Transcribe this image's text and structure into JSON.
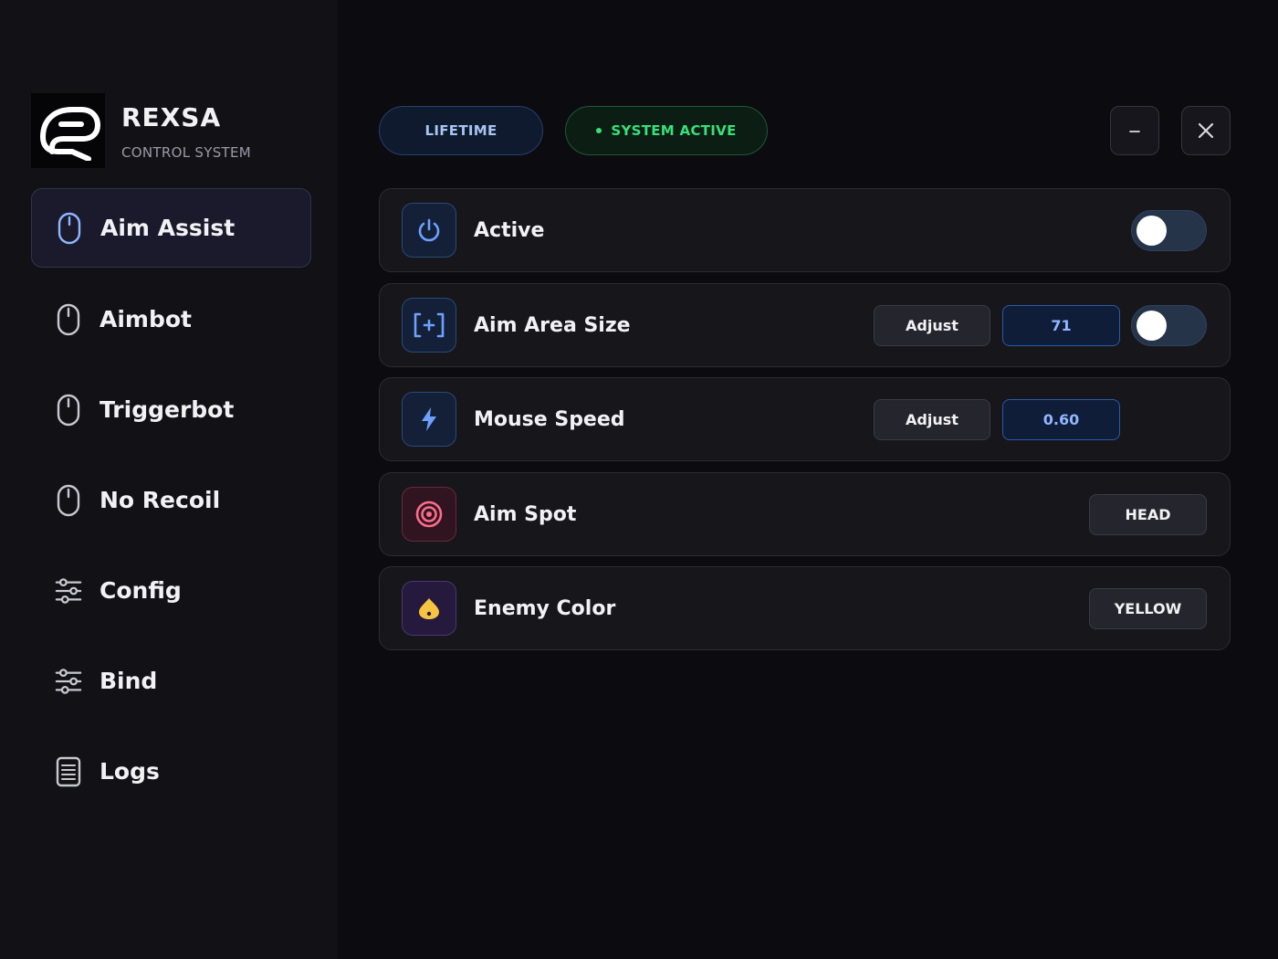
{
  "brand": {
    "name": "REXSA",
    "subtitle": "CONTROL SYSTEM",
    "logo_icon": "rexsa-logo-icon"
  },
  "sidebar": {
    "items": [
      {
        "label": "Aim Assist",
        "icon": "mouse-icon",
        "active": true
      },
      {
        "label": "Aimbot",
        "icon": "mouse-icon",
        "active": false
      },
      {
        "label": "Triggerbot",
        "icon": "mouse-icon",
        "active": false
      },
      {
        "label": "No Recoil",
        "icon": "mouse-icon",
        "active": false
      },
      {
        "label": "Config",
        "icon": "sliders-icon",
        "active": false
      },
      {
        "label": "Bind",
        "icon": "sliders-icon",
        "active": false
      },
      {
        "label": "Logs",
        "icon": "document-icon",
        "active": false
      }
    ]
  },
  "topbar": {
    "license_label": "LIFETIME",
    "status_label": "SYSTEM ACTIVE",
    "minimize_icon": "minimize-icon",
    "close_icon": "close-icon"
  },
  "settings": {
    "active": {
      "label": "Active",
      "icon": "power-icon",
      "enabled": false
    },
    "aim_area_size": {
      "label": "Aim Area Size",
      "icon": "crosshair-frame-icon",
      "adjust_label": "Adjust",
      "value": "71",
      "enabled": false
    },
    "mouse_speed": {
      "label": "Mouse Speed",
      "icon": "lightning-icon",
      "adjust_label": "Adjust",
      "value": "0.60"
    },
    "aim_spot": {
      "label": "Aim Spot",
      "icon": "target-icon",
      "value": "HEAD"
    },
    "enemy_color": {
      "label": "Enemy Color",
      "icon": "color-drop-icon",
      "value": "YELLOW"
    }
  },
  "colors": {
    "background": "#0c0c10",
    "sidebar": "#111116",
    "accent_blue": "#8fb6ff",
    "status_green": "#38e07a",
    "enemy_yellow": "#f5c542"
  }
}
